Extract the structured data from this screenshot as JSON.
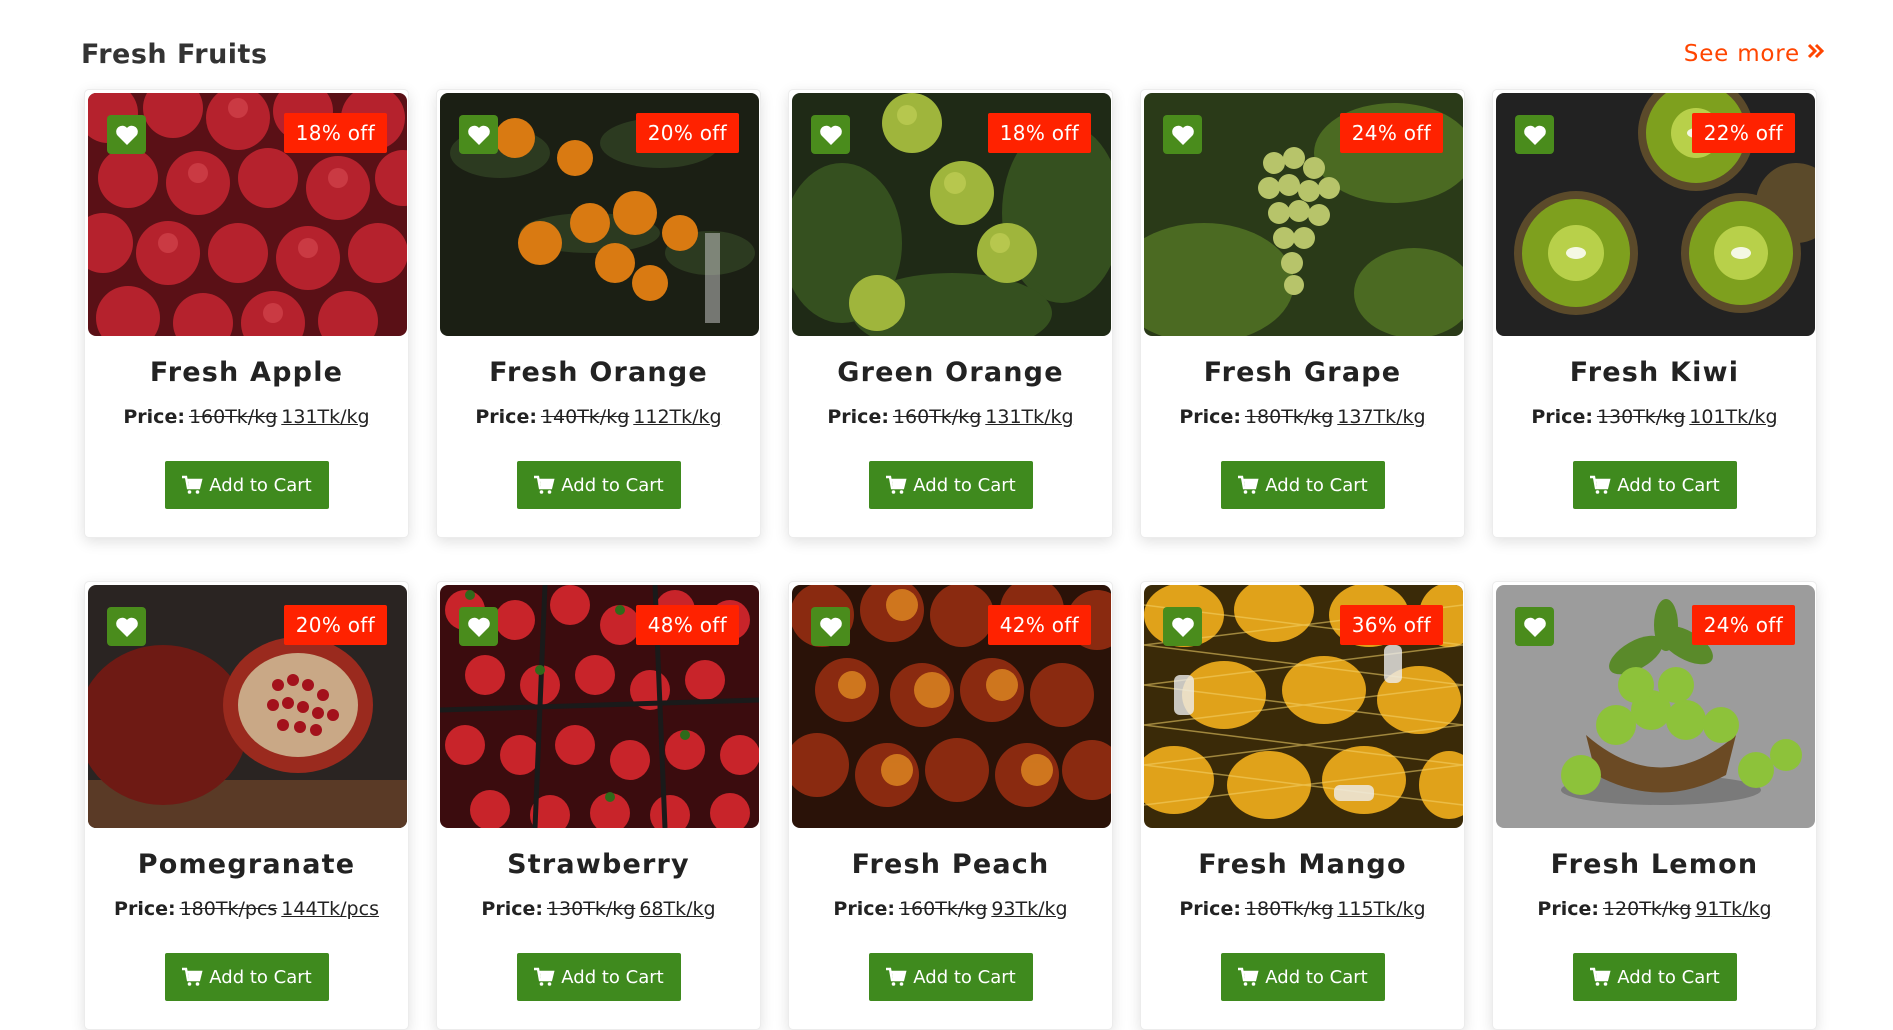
{
  "section": {
    "title": "Fresh Fruits",
    "see_more": "See more"
  },
  "colors": {
    "accent": "#ff4500",
    "badge": "#ff2200",
    "button": "#3f8a1e",
    "wishlist": "#4a8c1c"
  },
  "icons": {
    "see_more": "double-chevron-right-icon",
    "wishlist": "heart-icon",
    "cart": "cart-icon"
  },
  "products": [
    {
      "name": "Fresh Apple",
      "discount": "18% off",
      "price_label": "Price:",
      "old_price": "160Tk/kg",
      "new_price": "131Tk/kg",
      "button": "Add to Cart"
    },
    {
      "name": "Fresh Orange",
      "discount": "20% off",
      "price_label": "Price:",
      "old_price": "140Tk/kg",
      "new_price": "112Tk/kg",
      "button": "Add to Cart"
    },
    {
      "name": "Green Orange",
      "discount": "18% off",
      "price_label": "Price:",
      "old_price": "160Tk/kg",
      "new_price": "131Tk/kg",
      "button": "Add to Cart"
    },
    {
      "name": "Fresh Grape",
      "discount": "24% off",
      "price_label": "Price:",
      "old_price": "180Tk/kg",
      "new_price": "137Tk/kg",
      "button": "Add to Cart"
    },
    {
      "name": "Fresh Kiwi",
      "discount": "22% off",
      "price_label": "Price:",
      "old_price": "130Tk/kg",
      "new_price": "101Tk/kg",
      "button": "Add to Cart"
    },
    {
      "name": "Pomegranate",
      "discount": "20% off",
      "price_label": "Price:",
      "old_price": "180Tk/pcs",
      "new_price": "144Tk/pcs",
      "button": "Add to Cart"
    },
    {
      "name": "Strawberry",
      "discount": "48% off",
      "price_label": "Price:",
      "old_price": "130Tk/kg",
      "new_price": "68Tk/kg",
      "button": "Add to Cart"
    },
    {
      "name": "Fresh Peach",
      "discount": "42% off",
      "price_label": "Price:",
      "old_price": "160Tk/kg",
      "new_price": "93Tk/kg",
      "button": "Add to Cart"
    },
    {
      "name": "Fresh Mango",
      "discount": "36% off",
      "price_label": "Price:",
      "old_price": "180Tk/kg",
      "new_price": "115Tk/kg",
      "button": "Add to Cart"
    },
    {
      "name": "Fresh Lemon",
      "discount": "24% off",
      "price_label": "Price:",
      "old_price": "120Tk/kg",
      "new_price": "91Tk/kg",
      "button": "Add to Cart"
    }
  ]
}
